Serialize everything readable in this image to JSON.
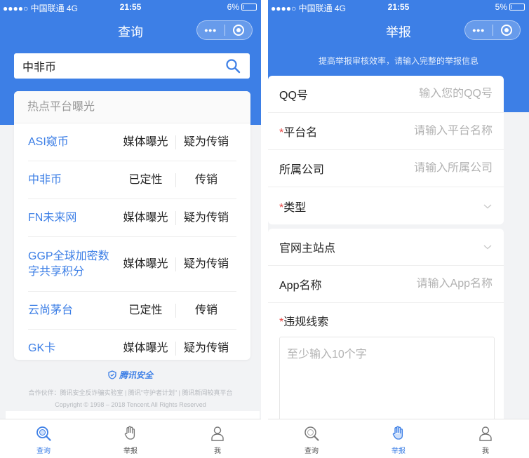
{
  "status_left": {
    "carrier": "●●●●○ 中国联通  4G",
    "time": "21:55",
    "battery": "6%",
    "battery_level": 0.06
  },
  "status_right": {
    "carrier": "●●●●○ 中国联通  4G",
    "time": "21:55",
    "battery": "5%",
    "battery_level": 0.05
  },
  "query_page": {
    "title": "查询",
    "search": {
      "value": "中非币",
      "placeholder": ""
    },
    "hot_title": "热点平台曝光",
    "hot_list": [
      {
        "name": "ASI窥币",
        "tag": "媒体曝光",
        "status": "疑为传销"
      },
      {
        "name": "中非币",
        "tag": "已定性",
        "status": "传销"
      },
      {
        "name": "FN未来网",
        "tag": "媒体曝光",
        "status": "疑为传销"
      },
      {
        "name": "GGP全球加密数字共享积分",
        "tag": "媒体曝光",
        "status": "疑为传销"
      },
      {
        "name": "云尚茅台",
        "tag": "已定性",
        "status": "传销"
      },
      {
        "name": "GK卡",
        "tag": "媒体曝光",
        "status": "疑为传销"
      }
    ],
    "footer": {
      "brand": "腾讯安全",
      "partners": "合作伙伴：腾讯安全反诈骗实验室 | 腾讯\"守护者计划\" | 腾讯新闻较真平台",
      "copyright": "Copyright © 1998 – 2018 Tencent.All Rights Reserved"
    }
  },
  "report_page": {
    "title": "举报",
    "tip": "提高举报审核效率，请输入完整的举报信息",
    "fields": {
      "qq": {
        "label": "QQ号",
        "placeholder": "输入您的QQ号"
      },
      "platform": {
        "required": "*",
        "label": "平台名",
        "placeholder": "请输入平台名称"
      },
      "company": {
        "label": "所属公司",
        "placeholder": "请输入所属公司"
      },
      "type": {
        "required": "*",
        "label": "类型"
      },
      "site": {
        "label": "官网主站点"
      },
      "app": {
        "label": "App名称",
        "placeholder": "请输入App名称"
      },
      "clue": {
        "required": "*",
        "label": "违规线索",
        "placeholder": "至少输入10个字"
      }
    }
  },
  "tabs": [
    {
      "label": "查询",
      "icon": "magnifier-tab-icon"
    },
    {
      "label": "举报",
      "icon": "raised-hand-icon"
    },
    {
      "label": "我",
      "icon": "person-icon"
    }
  ],
  "colors": {
    "primary": "#3d7fe6",
    "background": "#f2f3f5",
    "required": "#e64340"
  }
}
